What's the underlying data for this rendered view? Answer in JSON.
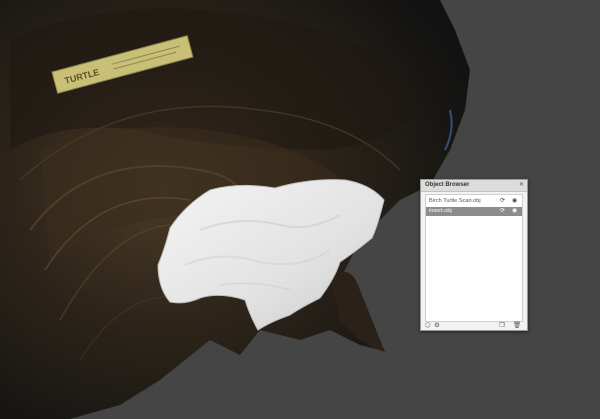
{
  "scene": {
    "label_text": "TURTLE",
    "background_color": "#454545",
    "mesh_color": "#e6e6e6"
  },
  "object_browser": {
    "title": "Object Browser",
    "close_icon": "close-icon",
    "items": [
      {
        "name": "Birch Turtle Scan.obj",
        "selected": false,
        "icons": [
          "transform-icon",
          "eye-icon"
        ]
      },
      {
        "name": "insert.obj",
        "selected": true,
        "icons": [
          "transform-icon",
          "eye-icon"
        ]
      }
    ],
    "footer_icons": [
      "add-object-icon",
      "settings-icon",
      "duplicate-icon",
      "trash-icon"
    ]
  }
}
